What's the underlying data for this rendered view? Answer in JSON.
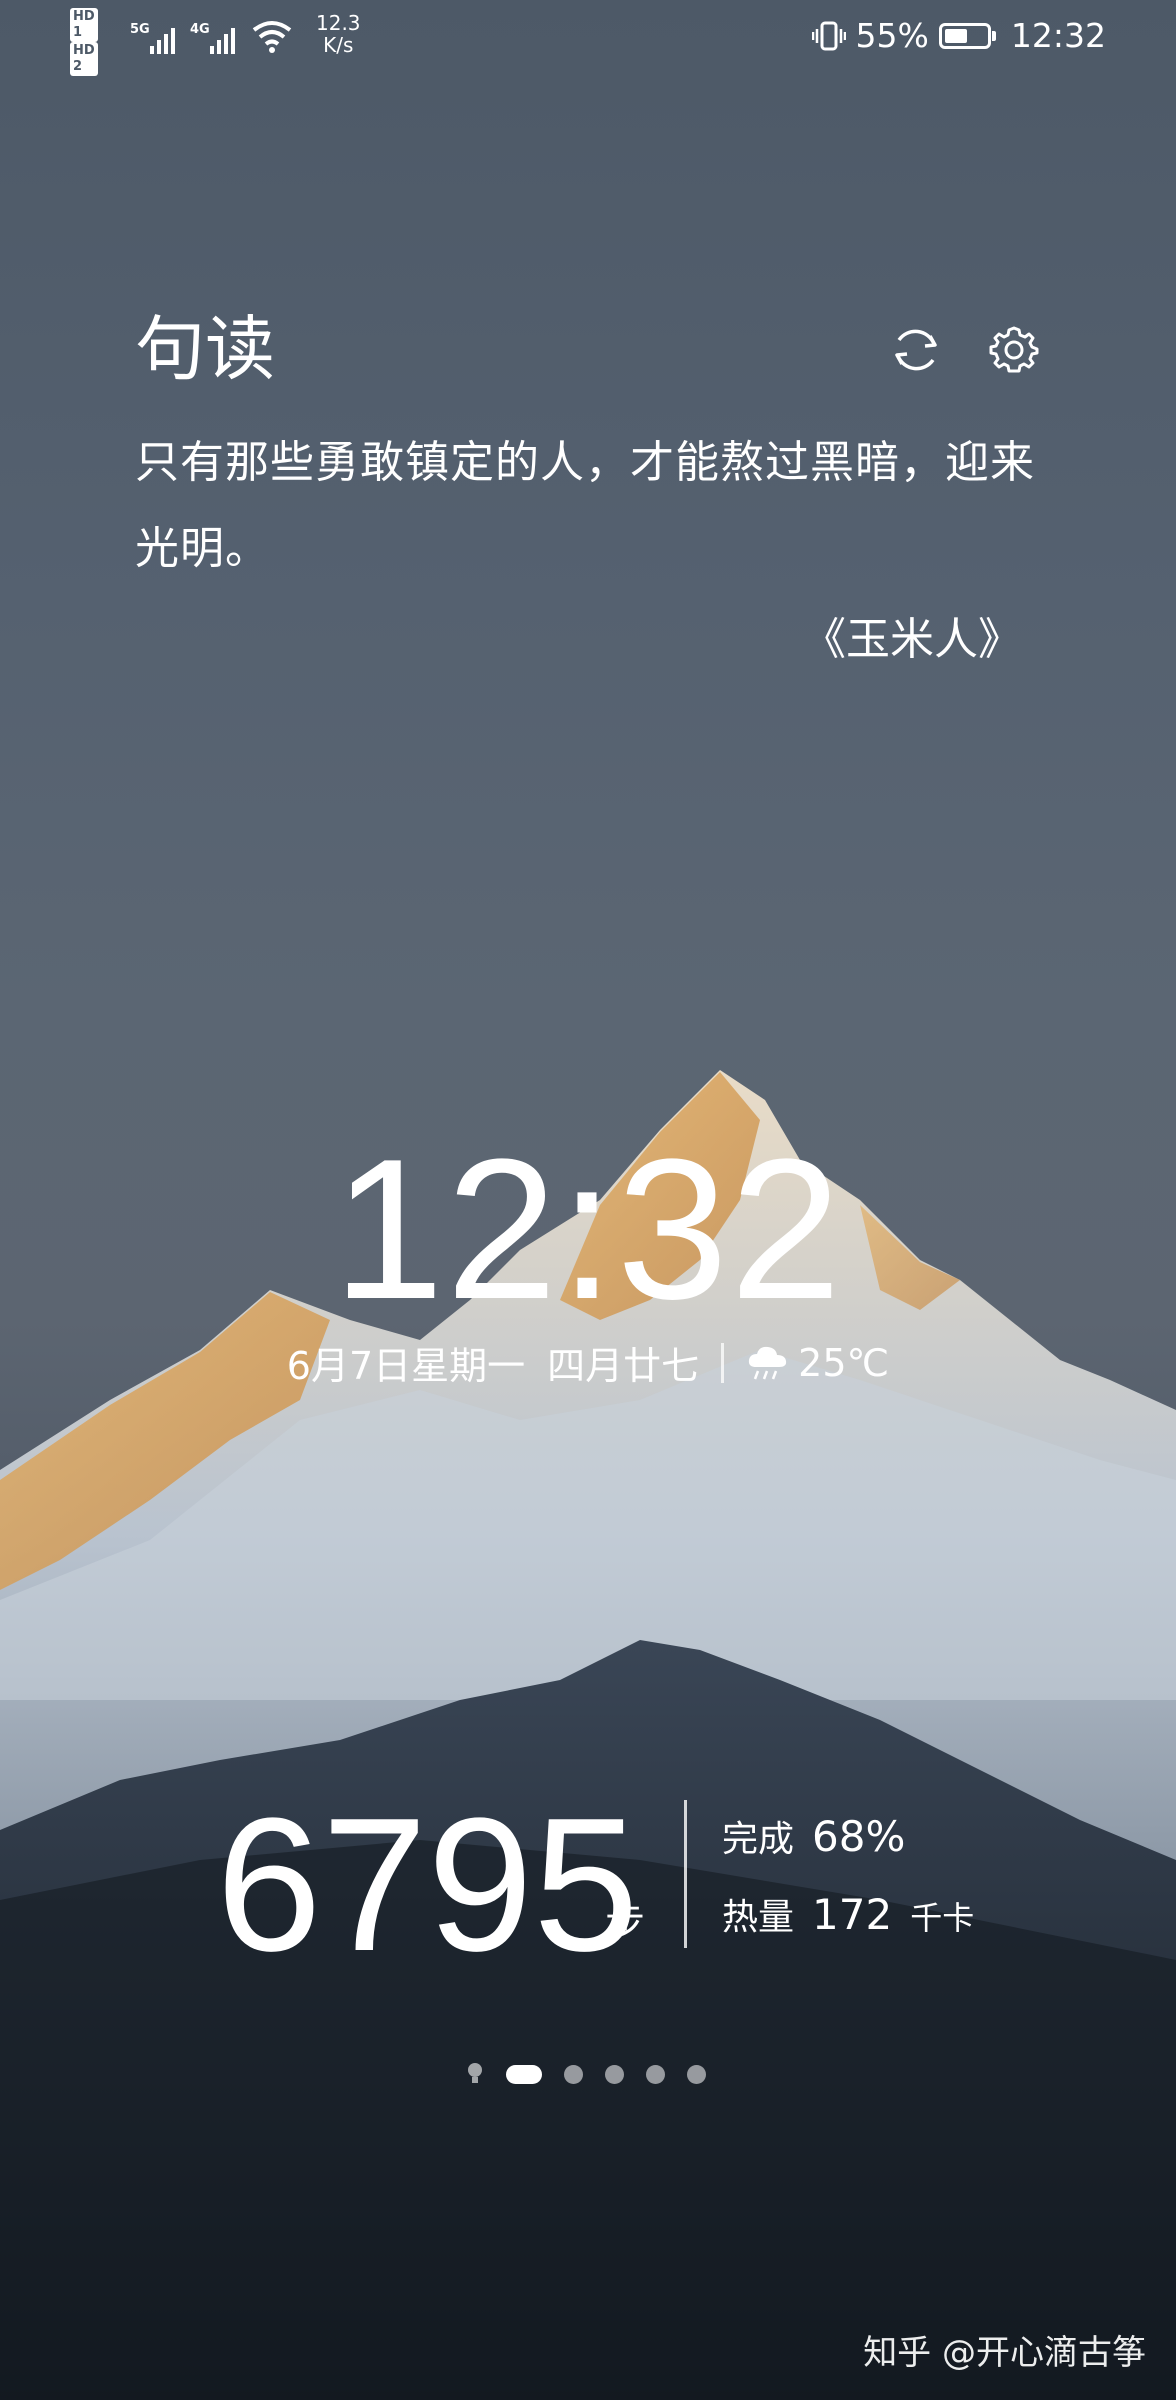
{
  "status_bar": {
    "sim1_label": "HD 1",
    "sim2_label": "HD 2",
    "sim1_network": "5G",
    "sim2_network": "4G",
    "net_speed_value": "12.3",
    "net_speed_unit": "K/s",
    "battery_percent": "55%",
    "battery_level": 0.55,
    "time": "12:32"
  },
  "quote_card": {
    "title": "句读",
    "text": "只有那些勇敢镇定的人，才能熬过黑暗，迎来光明。",
    "source": "《玉米人》"
  },
  "lock_clock": {
    "time": "12:32",
    "date": "6月7日星期一",
    "lunar_date": "四月廿七",
    "weather_icon": "cloud-rain-icon",
    "temperature": "25℃"
  },
  "steps": {
    "count": "6795",
    "unit": "步",
    "completion_label": "完成",
    "completion_value": "68%",
    "calories_label": "热量",
    "calories_value": "172",
    "calories_unit": "千卡"
  },
  "pager": {
    "pages": 6,
    "active_index": 1
  },
  "watermark": "知乎 @开心滴古筝"
}
